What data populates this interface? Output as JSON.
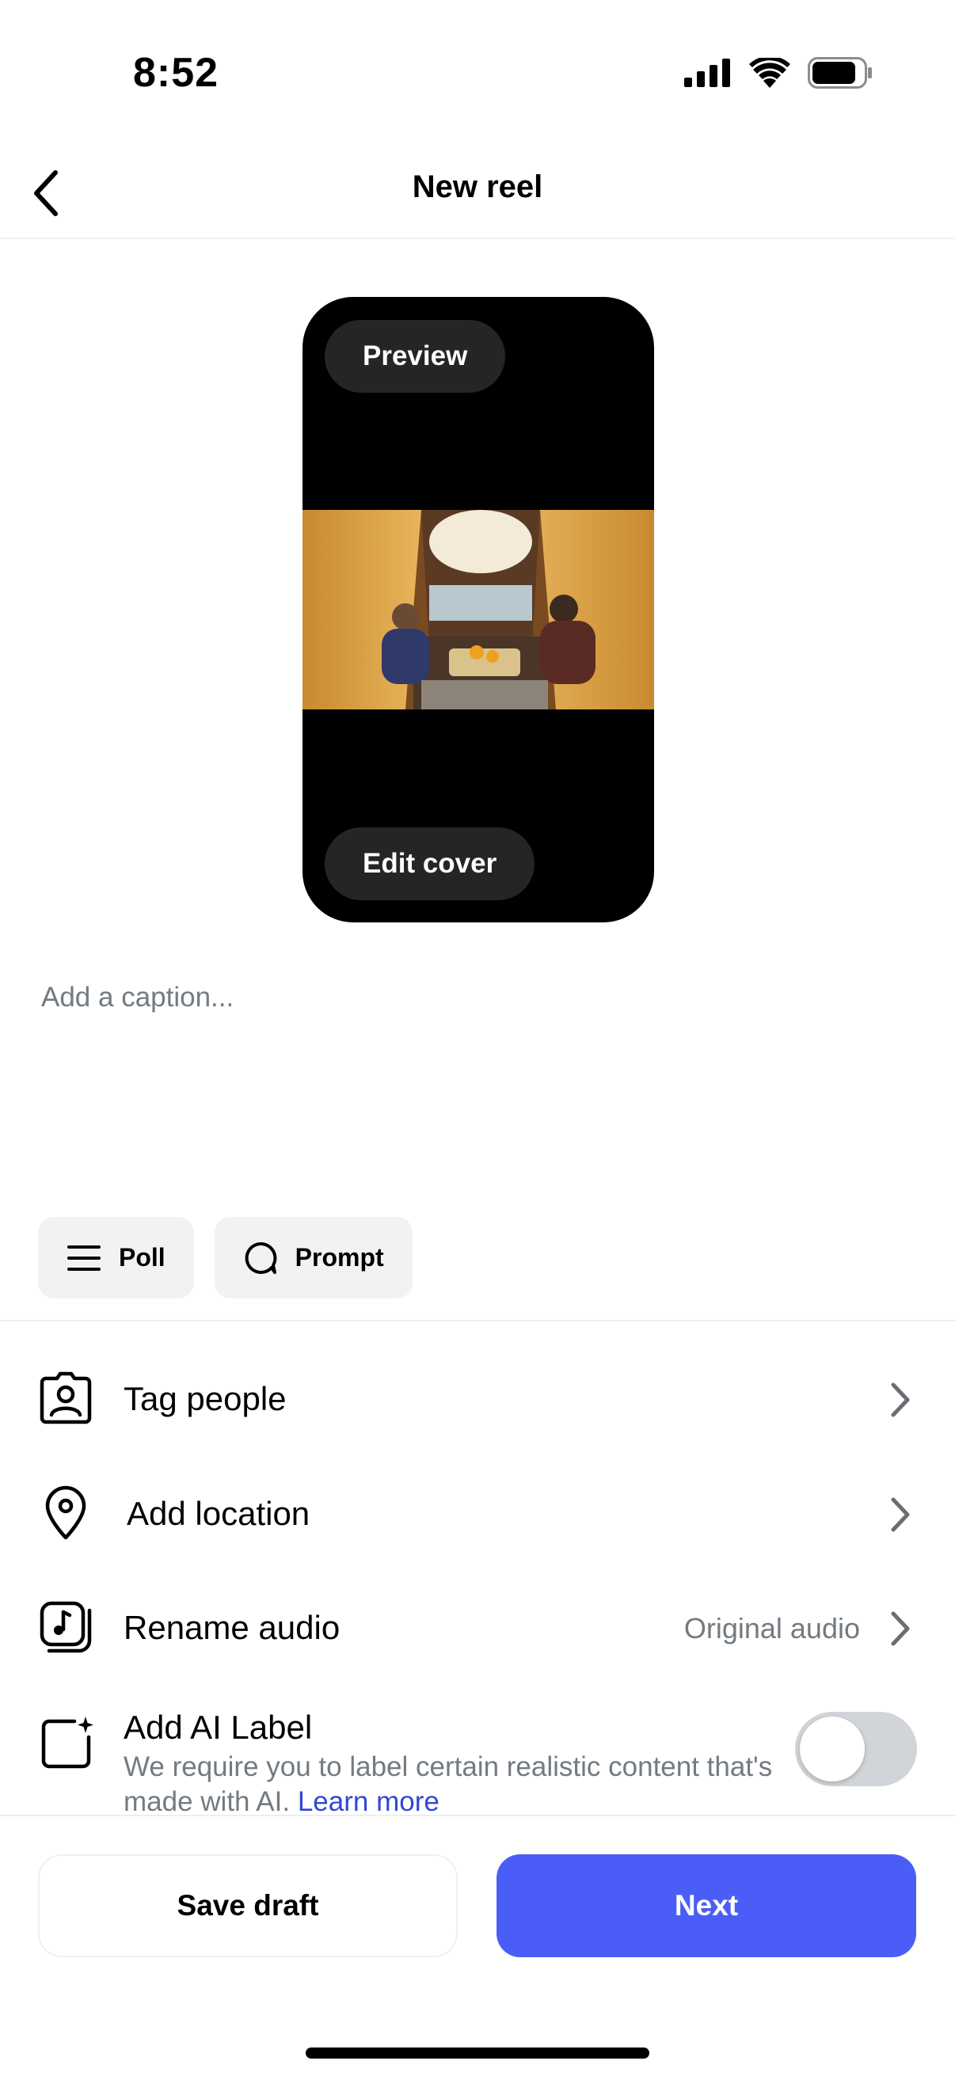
{
  "status_bar": {
    "time": "8:52",
    "icons": [
      "cellular-signal-icon",
      "wifi-icon",
      "battery-icon"
    ]
  },
  "header": {
    "title": "New reel",
    "back_icon": "chevron-left-icon"
  },
  "preview": {
    "preview_label": "Preview",
    "edit_cover_label": "Edit cover"
  },
  "caption": {
    "placeholder": "Add a caption..."
  },
  "chips": [
    {
      "label": "Poll",
      "icon": "list-icon"
    },
    {
      "label": "Prompt",
      "icon": "chat-bubble-icon"
    }
  ],
  "options": [
    {
      "label": "Tag people",
      "icon": "tag-person-icon"
    },
    {
      "label": "Add location",
      "icon": "location-pin-icon"
    },
    {
      "label": "Rename audio",
      "value": "Original audio",
      "icon": "music-note-icon"
    }
  ],
  "ai_label": {
    "title": "Add AI Label",
    "description": "We require you to label certain realistic content that's made with AI.",
    "link": "Learn more",
    "enabled": false
  },
  "footer": {
    "save_draft_label": "Save draft",
    "next_label": "Next"
  },
  "colors": {
    "accent": "#4a5ef7",
    "link": "#3147d4",
    "muted_text": "#737a80",
    "chip_bg": "#f1f2f4"
  }
}
